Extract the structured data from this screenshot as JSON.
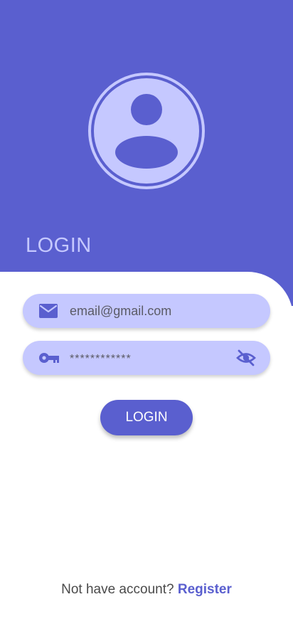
{
  "header": {
    "title": "LOGIN",
    "avatar_icon": "account-circle-icon"
  },
  "form": {
    "email": {
      "icon": "mail-icon",
      "value": "email@gmail.com"
    },
    "password": {
      "icon": "key-icon",
      "value": "************",
      "toggle_icon": "eye-off-icon"
    },
    "submit_label": "LOGIN"
  },
  "footer": {
    "prompt": "Not have account?",
    "register_label": "Register"
  },
  "colors": {
    "primary": "#5a5fcf",
    "primary_light": "#c5c8ff",
    "background": "#ffffff"
  }
}
